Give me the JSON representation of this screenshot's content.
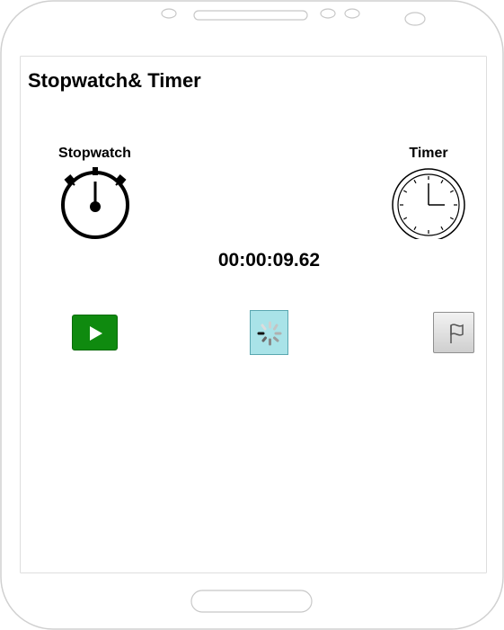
{
  "app": {
    "title": "Stopwatch& Timer"
  },
  "modes": {
    "stopwatch": {
      "label": "Stopwatch",
      "icon": "stopwatch-icon"
    },
    "timer": {
      "label": "Timer",
      "icon": "clock-icon"
    }
  },
  "display": {
    "time": "00:00:09.62"
  },
  "controls": {
    "play": {
      "icon": "play-icon",
      "color": "#0f8a0f"
    },
    "reset": {
      "icon": "spinner-icon",
      "color": "#a9e3e8"
    },
    "lap": {
      "icon": "flag-icon"
    }
  }
}
